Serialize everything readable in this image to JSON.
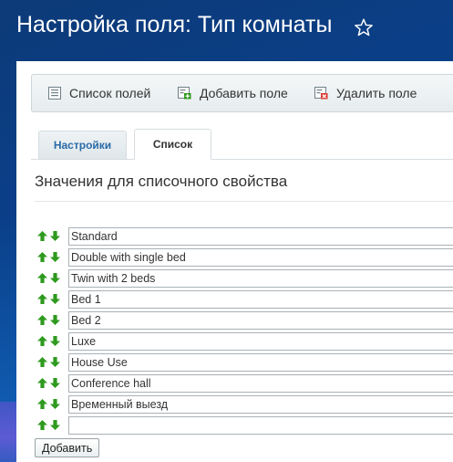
{
  "header": {
    "title": "Настройка поля: Тип комнаты",
    "star_icon": "star-outline-icon"
  },
  "toolbar": {
    "list_fields": {
      "label": "Список полей",
      "icon": "list-icon"
    },
    "add_field": {
      "label": "Добавить поле",
      "icon": "add-field-icon"
    },
    "delete_field": {
      "label": "Удалить поле",
      "icon": "delete-field-icon"
    }
  },
  "tabs": [
    {
      "label": "Настройки",
      "active": false
    },
    {
      "label": "Список",
      "active": true
    }
  ],
  "section": {
    "title": "Значения для списочного свойства"
  },
  "values": [
    "Standard",
    "Double with single bed",
    "Twin with 2 beds",
    "Bed 1",
    "Bed 2",
    "Luxe",
    "House Use",
    "Conference hall",
    "Временный выезд",
    ""
  ],
  "add_button": {
    "label": "Добавить"
  },
  "colors": {
    "arrow_green": "#2e9a1e",
    "tab_active_text": "#333333",
    "tab_inactive_text": "#2b6aa7",
    "background_blue": "#0a3f88"
  }
}
